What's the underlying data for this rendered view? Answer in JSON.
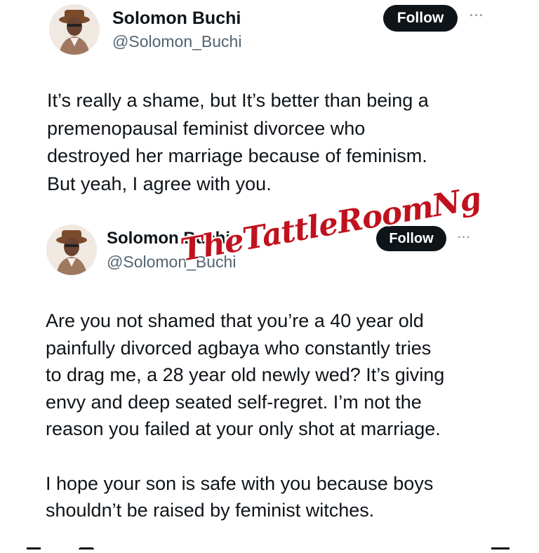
{
  "tweets": [
    {
      "name": "Solomon Buchi",
      "handle": "@Solomon_Buchi",
      "follow_label": "Follow",
      "more_label": "···",
      "text": "It’s really a shame, but It’s better than being a\npremenopausal feminist divorcee who\ndestroyed her marriage because of feminism.\nBut yeah, I agree with you."
    },
    {
      "name": "Solomon Buchi",
      "handle": "@Solomon_Buchi",
      "follow_label": "Follow",
      "more_label": "···",
      "text": "Are you not shamed that you’re a 40 year old\npainfully divorced agbaya who constantly tries\nto drag me, a 28 year old newly wed? It’s giving\nenvy and deep seated self-regret. I’m not the\nreason you failed at your only shot at marriage.\n\nI hope your son is safe with you because boys\nshouldn’t be raised by feminist witches."
    }
  ],
  "watermark": "TheTattleRoomNg",
  "colors": {
    "text": "#0f1419",
    "secondary": "#536471",
    "follow_bg": "#0f1419",
    "watermark": "#c0121e"
  },
  "icons": {
    "more": "more-dots-icon",
    "avatar": "profile-avatar"
  }
}
